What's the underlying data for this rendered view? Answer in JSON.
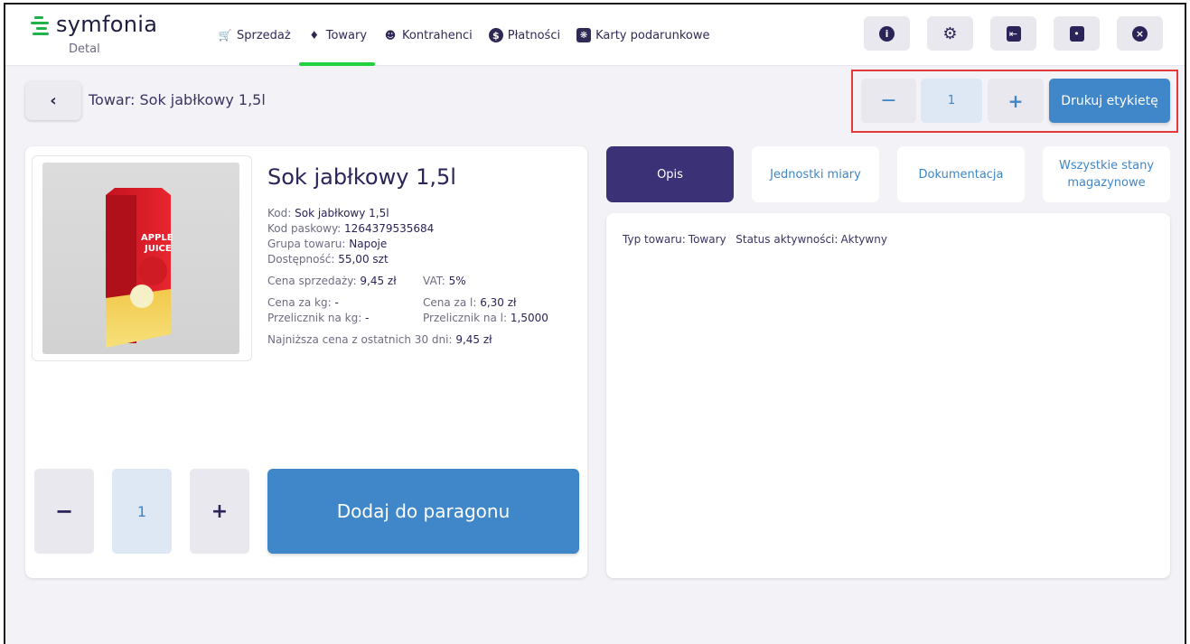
{
  "app": {
    "brand": "symfonia",
    "sub": "Detal",
    "brand_color": "#22b24c"
  },
  "nav": {
    "items": [
      {
        "label": "Sprzedaż",
        "icon": "cart-icon"
      },
      {
        "label": "Towary",
        "icon": "tag-icon",
        "active": true
      },
      {
        "label": "Kontrahenci",
        "icon": "contacts-icon"
      },
      {
        "label": "Płatności",
        "icon": "dollar-icon"
      },
      {
        "label": "Karty podarunkowe",
        "icon": "gift-card-icon"
      }
    ],
    "active_color": "#22d13f"
  },
  "top_actions": [
    "info-icon",
    "settings-icon",
    "logout-icon",
    "lock-icon",
    "close-icon"
  ],
  "header": {
    "breadcrumb": "Towar: Sok jabłkowy 1,5l",
    "label_qty": "1",
    "label_minus": "−",
    "label_plus": "+",
    "print_label": "Drukuj etykietę"
  },
  "product": {
    "name": "Sok jabłkowy 1,5l",
    "image_text_1": "APPLE",
    "image_text_2": "JUICE",
    "kod_label": "Kod:",
    "kod": "Sok jabłkowy 1,5l",
    "barcode_label": "Kod paskowy:",
    "barcode": "1264379535684",
    "group_label": "Grupa towaru:",
    "group": "Napoje",
    "availability_label": "Dostępność:",
    "availability": "55,00 szt",
    "price_label": "Cena sprzedaży:",
    "price": "9,45 zł",
    "vat_label": "VAT:",
    "vat": "5%",
    "price_kg_label": "Cena za kg:",
    "price_kg": "-",
    "price_l_label": "Cena za l:",
    "price_l": "6,30 zł",
    "conv_kg_label": "Przelicznik na kg:",
    "conv_kg": "-",
    "conv_l_label": "Przelicznik na l:",
    "conv_l": "1,5000",
    "lowest_label": "Najniższa cena z ostatnich 30 dni:",
    "lowest": "9,45 zł"
  },
  "cart": {
    "minus": "−",
    "qty": "1",
    "plus": "+",
    "add_label": "Dodaj do paragonu"
  },
  "tabs": [
    {
      "label": "Opis",
      "active": true
    },
    {
      "label": "Jednostki miary"
    },
    {
      "label": "Dokumentacja"
    },
    {
      "label": "Wszystkie stany magazynowe"
    }
  ],
  "description": {
    "type_label": "Typ towaru:",
    "type": "Towary",
    "status_label": "Status aktywności:",
    "status": "Aktywny"
  },
  "colors": {
    "primary_dark": "#3b3176",
    "button_blue": "#3f87c8",
    "highlight": "#e23a3a"
  }
}
